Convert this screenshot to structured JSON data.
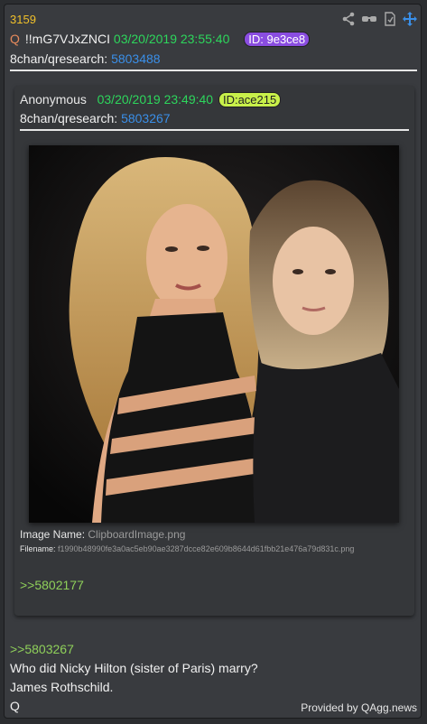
{
  "post": {
    "number": "3159",
    "q_marker": "Q",
    "tripcode": "!!mG7VJxZNCI",
    "date": "03/20/2019 23:55:40",
    "id_badge": "ID: 9e3ce8",
    "source_prefix": "8chan/qresearch:",
    "source_link": "5803488"
  },
  "quoted": {
    "author": "Anonymous",
    "date": "03/20/2019 23:49:40",
    "id_badge": "ID:ace215",
    "source_prefix": "8chan/qresearch:",
    "source_link": "5803267",
    "image_name_label": "Image Name:",
    "image_name": "ClipboardImage.png",
    "filename_label": "Filename:",
    "filename": "f1990b48990fe3a0ac5eb90ae3287dcce82e609b8644d61fbb21e476a79d831c.png",
    "reply_ref": ">>5802177"
  },
  "body": {
    "reply_ref": ">>5803267",
    "line1": "Who did Nicky Hilton (sister of Paris) marry?",
    "line2": "James Rothschild.",
    "line3": "Q"
  },
  "footer": {
    "provided": "Provided by QAgg.news"
  },
  "icons": [
    "share-icon",
    "glasses-icon",
    "document-icon",
    "move-icon"
  ],
  "colors": {
    "post_number": "#f0c02a",
    "date": "#2dd65c",
    "link": "#3a8fe8",
    "reply": "#8fd05a",
    "id_purple": "#8a4de0",
    "id_yellow": "#c8f04a"
  }
}
